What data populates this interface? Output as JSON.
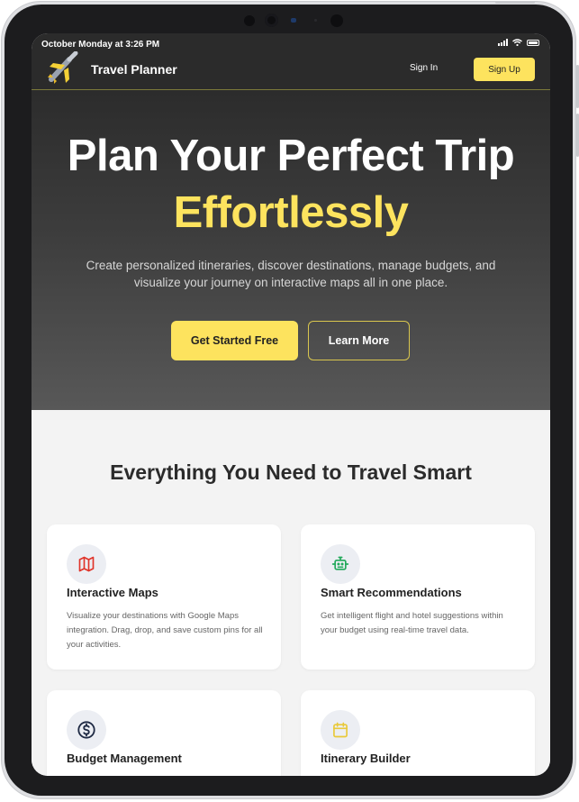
{
  "status_bar": {
    "time": "October Monday at 3:26 PM"
  },
  "nav": {
    "brand": "Travel Planner",
    "sign_in": "Sign In",
    "sign_up": "Sign Up"
  },
  "hero": {
    "title": "Plan Your Perfect Trip",
    "accent": "Effortlessly",
    "subtitle": "Create personalized itineraries, discover destinations, manage budgets, and visualize your journey on interactive maps all in one place.",
    "primary_button": "Get Started Free",
    "secondary_button": "Learn More"
  },
  "features": {
    "title": "Everything You Need to Travel Smart",
    "cards": [
      {
        "icon": "map-icon",
        "icon_color": "#e0342a",
        "title": "Interactive Maps",
        "description": "Visualize your destinations with Google Maps integration. Drag, drop, and save custom pins for all your activities."
      },
      {
        "icon": "robot-icon",
        "icon_color": "#22a95b",
        "title": "Smart Recommendations",
        "description": "Get intelligent flight and hotel suggestions within your budget using real-time travel data."
      },
      {
        "icon": "dollar-icon",
        "icon_color": "#1f2a44",
        "title": "Budget Management",
        "description": ""
      },
      {
        "icon": "calendar-icon",
        "icon_color": "#e9c93a",
        "title": "Itinerary Builder",
        "description": ""
      }
    ]
  },
  "colors": {
    "accent": "#fde35e",
    "header_bg": "#2b2b2b",
    "page_bg": "#f3f3f3"
  }
}
